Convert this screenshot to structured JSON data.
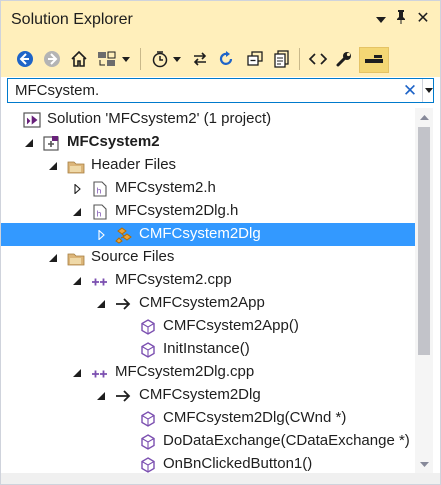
{
  "window": {
    "title": "Solution Explorer"
  },
  "title_buttons": {
    "menu_icon": "chevron-down",
    "pin_icon": "pin",
    "close_icon": "close"
  },
  "toolbar": {
    "icons": [
      "back",
      "forward",
      "home",
      "sync-with-active-document",
      "pending-changes-filter",
      "sync",
      "refresh",
      "collapse-all",
      "show-all-files",
      "view-code",
      "properties",
      "preview-selected-items"
    ]
  },
  "search": {
    "value": "MFCsystem.",
    "clear_glyph": "✕"
  },
  "tree": {
    "rows": [
      {
        "label": "Solution 'MFCsystem2' (1 project)",
        "icon": "solution",
        "expander": "",
        "bold": false
      },
      {
        "label": "MFCsystem2",
        "icon": "project",
        "expander": "expanded",
        "bold": true
      },
      {
        "label": "Header Files",
        "icon": "folder",
        "expander": "expanded",
        "bold": false
      },
      {
        "label": "MFCsystem2.h",
        "icon": "header-file",
        "expander": "collapsed",
        "bold": false
      },
      {
        "label": "MFCsystem2Dlg.h",
        "icon": "header-file",
        "expander": "expanded",
        "bold": false
      },
      {
        "label": "CMFCsystem2Dlg",
        "icon": "class",
        "expander": "collapsed",
        "bold": false,
        "selected": true
      },
      {
        "label": "Source Files",
        "icon": "folder",
        "expander": "expanded",
        "bold": false
      },
      {
        "label": "MFCsystem2.cpp",
        "icon": "cpp-file",
        "expander": "expanded",
        "bold": false
      },
      {
        "label": "CMFCsystem2App",
        "icon": "class-arrow",
        "expander": "expanded",
        "bold": false
      },
      {
        "label": "CMFCsystem2App()",
        "icon": "method",
        "expander": "",
        "bold": false
      },
      {
        "label": "InitInstance()",
        "icon": "method",
        "expander": "",
        "bold": false
      },
      {
        "label": "MFCsystem2Dlg.cpp",
        "icon": "cpp-file",
        "expander": "expanded",
        "bold": false
      },
      {
        "label": "CMFCsystem2Dlg",
        "icon": "class-arrow",
        "expander": "expanded",
        "bold": false
      },
      {
        "label": "CMFCsystem2Dlg(CWnd *)",
        "icon": "method",
        "expander": "",
        "bold": false
      },
      {
        "label": "DoDataExchange(CDataExchange *)",
        "icon": "method",
        "expander": "",
        "bold": false
      },
      {
        "label": "OnBnClickedButton1()",
        "icon": "method",
        "expander": "",
        "bold": false
      }
    ]
  },
  "colors": {
    "title_bg": "#ffefbb",
    "selection": "#3399ff",
    "accent_blue": "#1e64c8",
    "method_purple": "#7b4fb0"
  }
}
